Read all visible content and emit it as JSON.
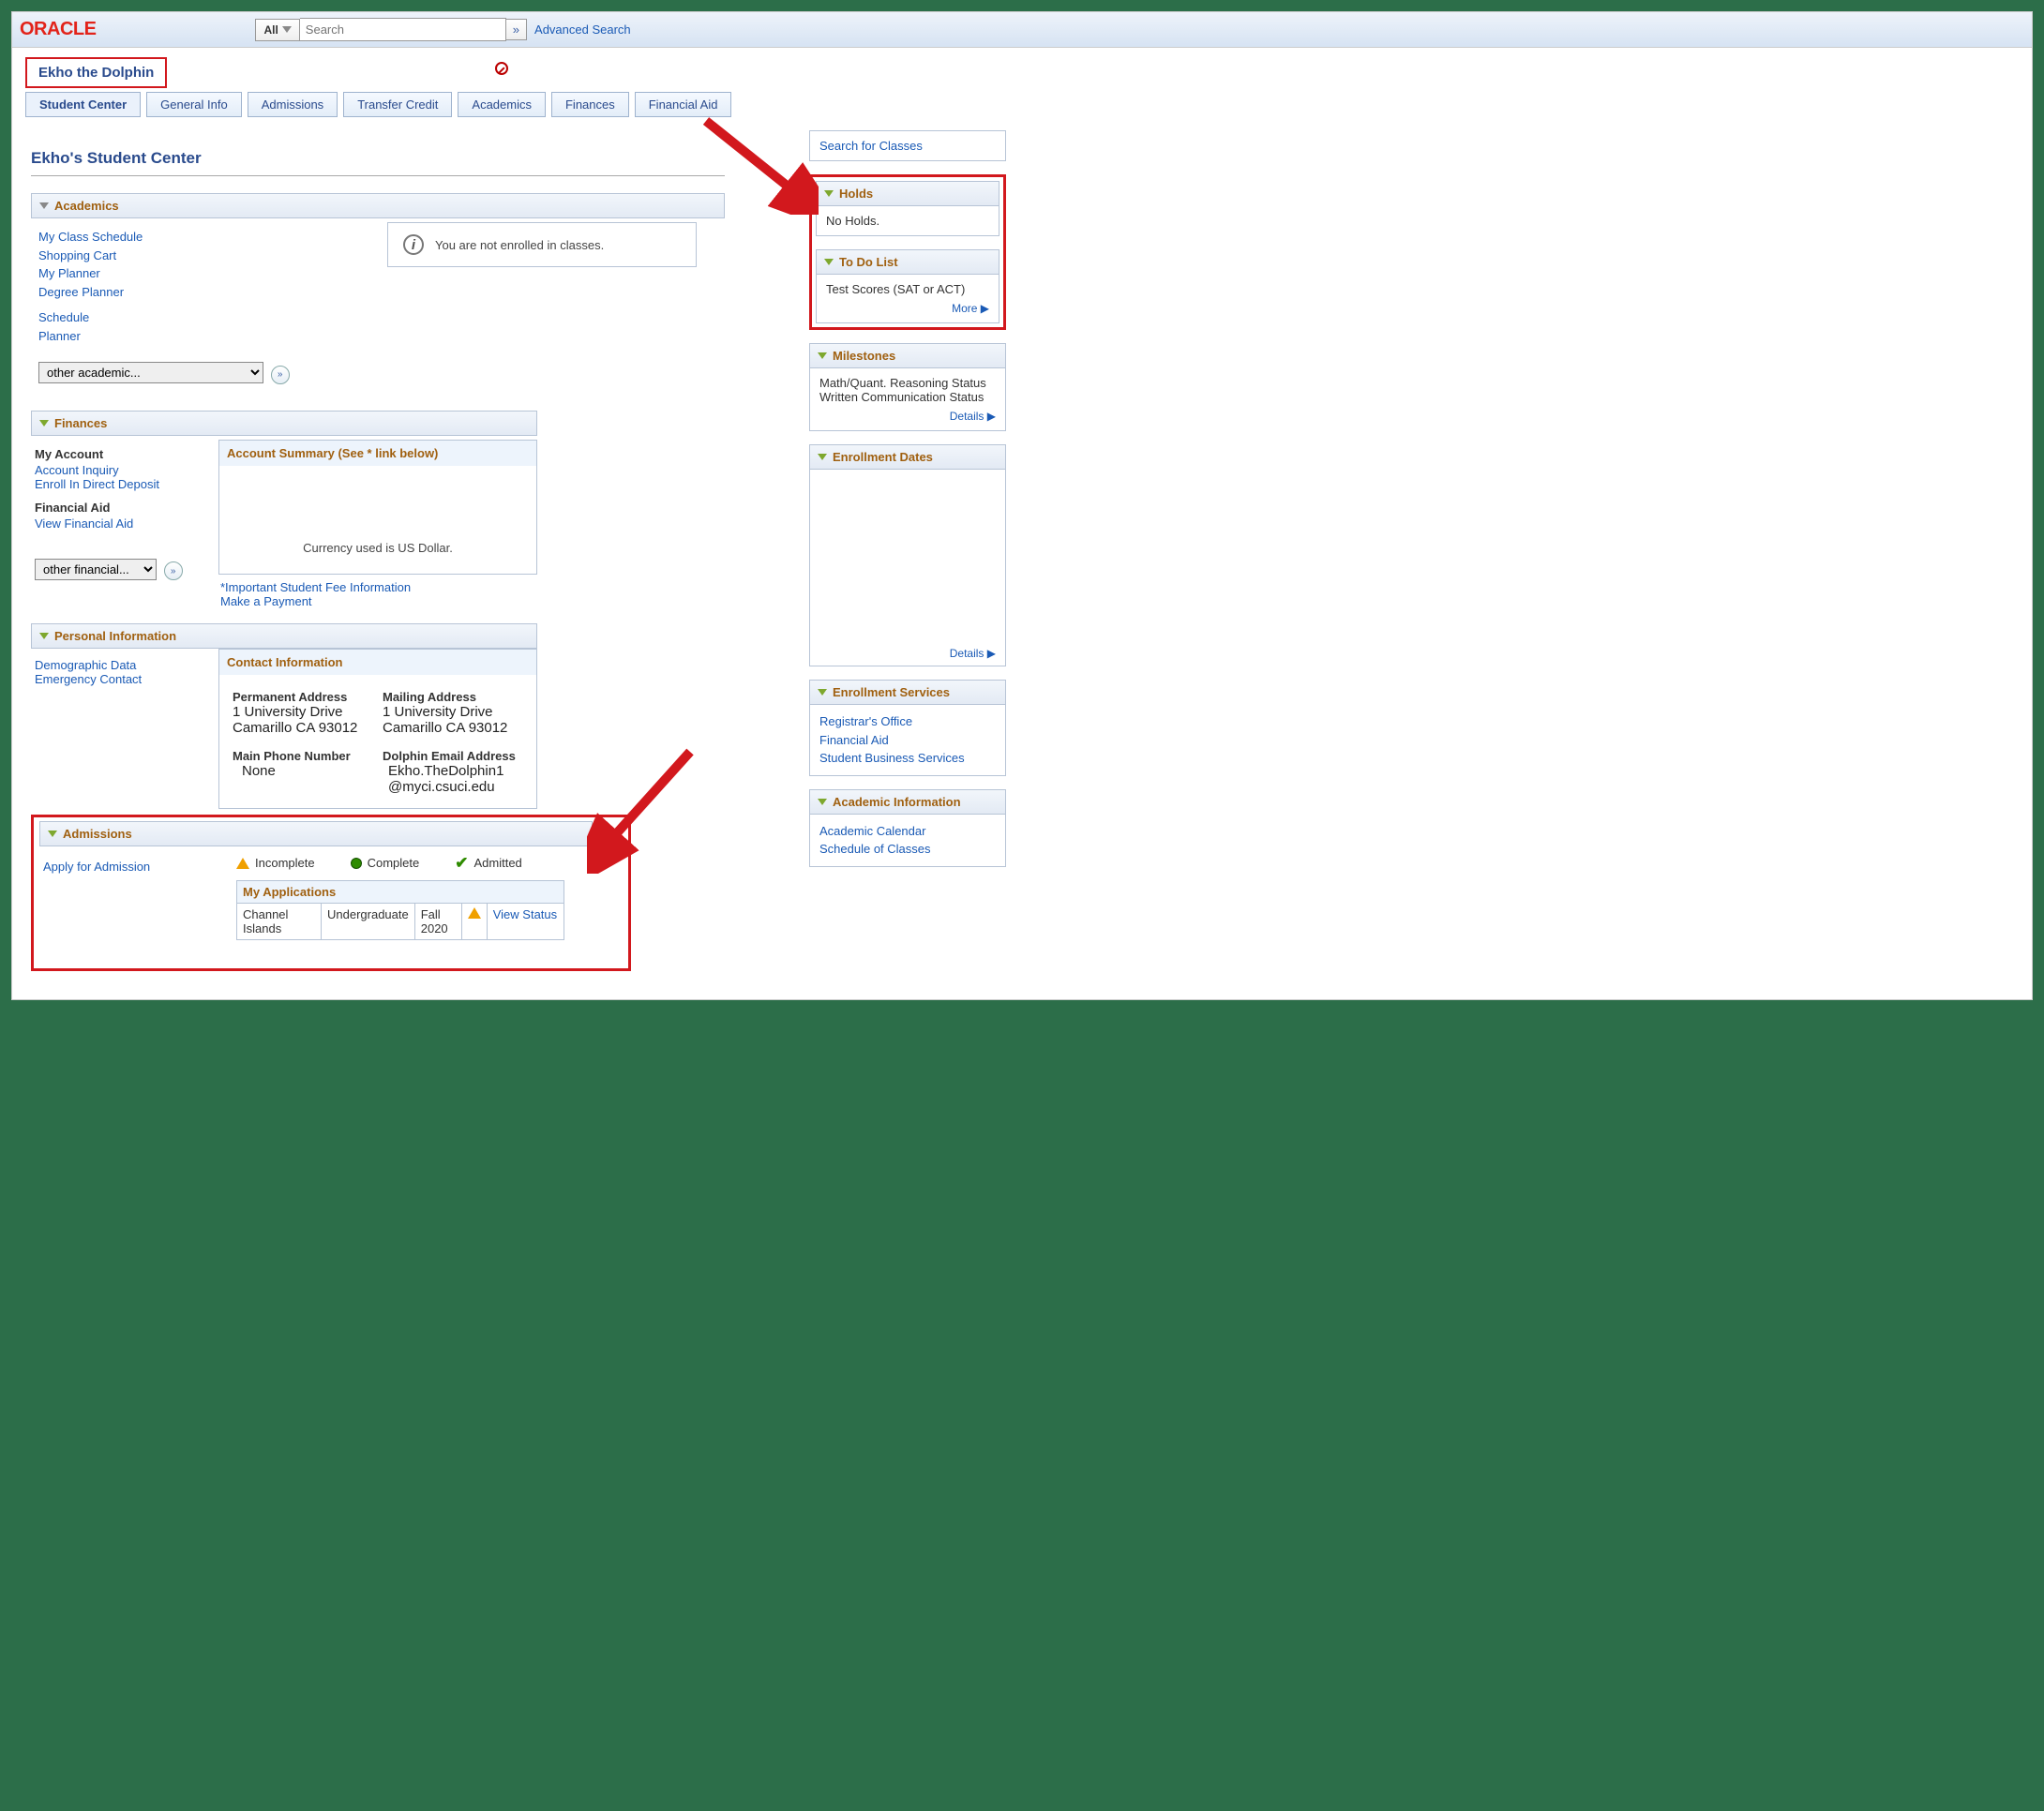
{
  "brand": "ORACLE",
  "search": {
    "all_label": "All",
    "placeholder": "Search",
    "adv": "Advanced Search"
  },
  "student_name": "Ekho the Dolphin",
  "tabs": [
    "Student Center",
    "General Info",
    "Admissions",
    "Transfer Credit",
    "Academics",
    "Finances",
    "Financial Aid"
  ],
  "page_title": "Ekho's Student Center",
  "academics": {
    "title": "Academics",
    "links": [
      "My Class Schedule",
      "Shopping Cart",
      "My Planner",
      "Degree Planner"
    ],
    "links2": [
      "Schedule",
      "Planner"
    ],
    "dropdown": "other academic...",
    "not_enrolled": "You are not enrolled in classes."
  },
  "finances": {
    "title": "Finances",
    "my_account_label": "My Account",
    "acct_links": [
      "Account Inquiry",
      "Enroll In Direct Deposit"
    ],
    "finaid_label": "Financial Aid",
    "finaid_link": "View Financial Aid",
    "dropdown": "other financial...",
    "summary_title": "Account Summary (See * link below)",
    "currency_note": "Currency used is US Dollar.",
    "fee_link": "*Important Student Fee Information",
    "pay_link": "Make a Payment"
  },
  "personal": {
    "title": "Personal Information",
    "links": [
      "Demographic Data",
      "Emergency Contact"
    ],
    "contact_title": "Contact Information",
    "perm_label": "Permanent Address",
    "perm_val1": "1 University Drive",
    "perm_val2": "Camarillo CA 93012",
    "mail_label": "Mailing Address",
    "mail_val1": "1 University Drive",
    "mail_val2": "Camarillo CA 93012",
    "phone_label": "Main Phone Number",
    "phone_val": "None",
    "email_label": "Dolphin Email Address",
    "email_val1": "Ekho.TheDolphin1",
    "email_val2": "@myci.csuci.edu"
  },
  "admissions": {
    "title": "Admissions",
    "apply_link": "Apply for Admission",
    "legend": {
      "incomplete": "Incomplete",
      "complete": "Complete",
      "admitted": "Admitted"
    },
    "apps_title": "My Applications",
    "row": {
      "campus": "Channel Islands",
      "level": "Undergraduate",
      "term": "Fall 2020",
      "action": "View Status"
    }
  },
  "side": {
    "search_classes": "Search for Classes",
    "holds_title": "Holds",
    "holds_body": "No Holds.",
    "todo_title": "To Do List",
    "todo_item": "Test Scores (SAT or ACT)",
    "more": "More",
    "milestones_title": "Milestones",
    "mile1": "Math/Quant. Reasoning Status",
    "mile2": "Written Communication Status",
    "details": "Details",
    "enroll_dates_title": "Enrollment Dates",
    "enroll_svc_title": "Enrollment Services",
    "svc_links": [
      "Registrar's Office",
      "Financial Aid",
      "Student Business Services"
    ],
    "acad_info_title": "Academic Information",
    "acad_links": [
      "Academic Calendar",
      "Schedule of Classes"
    ]
  }
}
